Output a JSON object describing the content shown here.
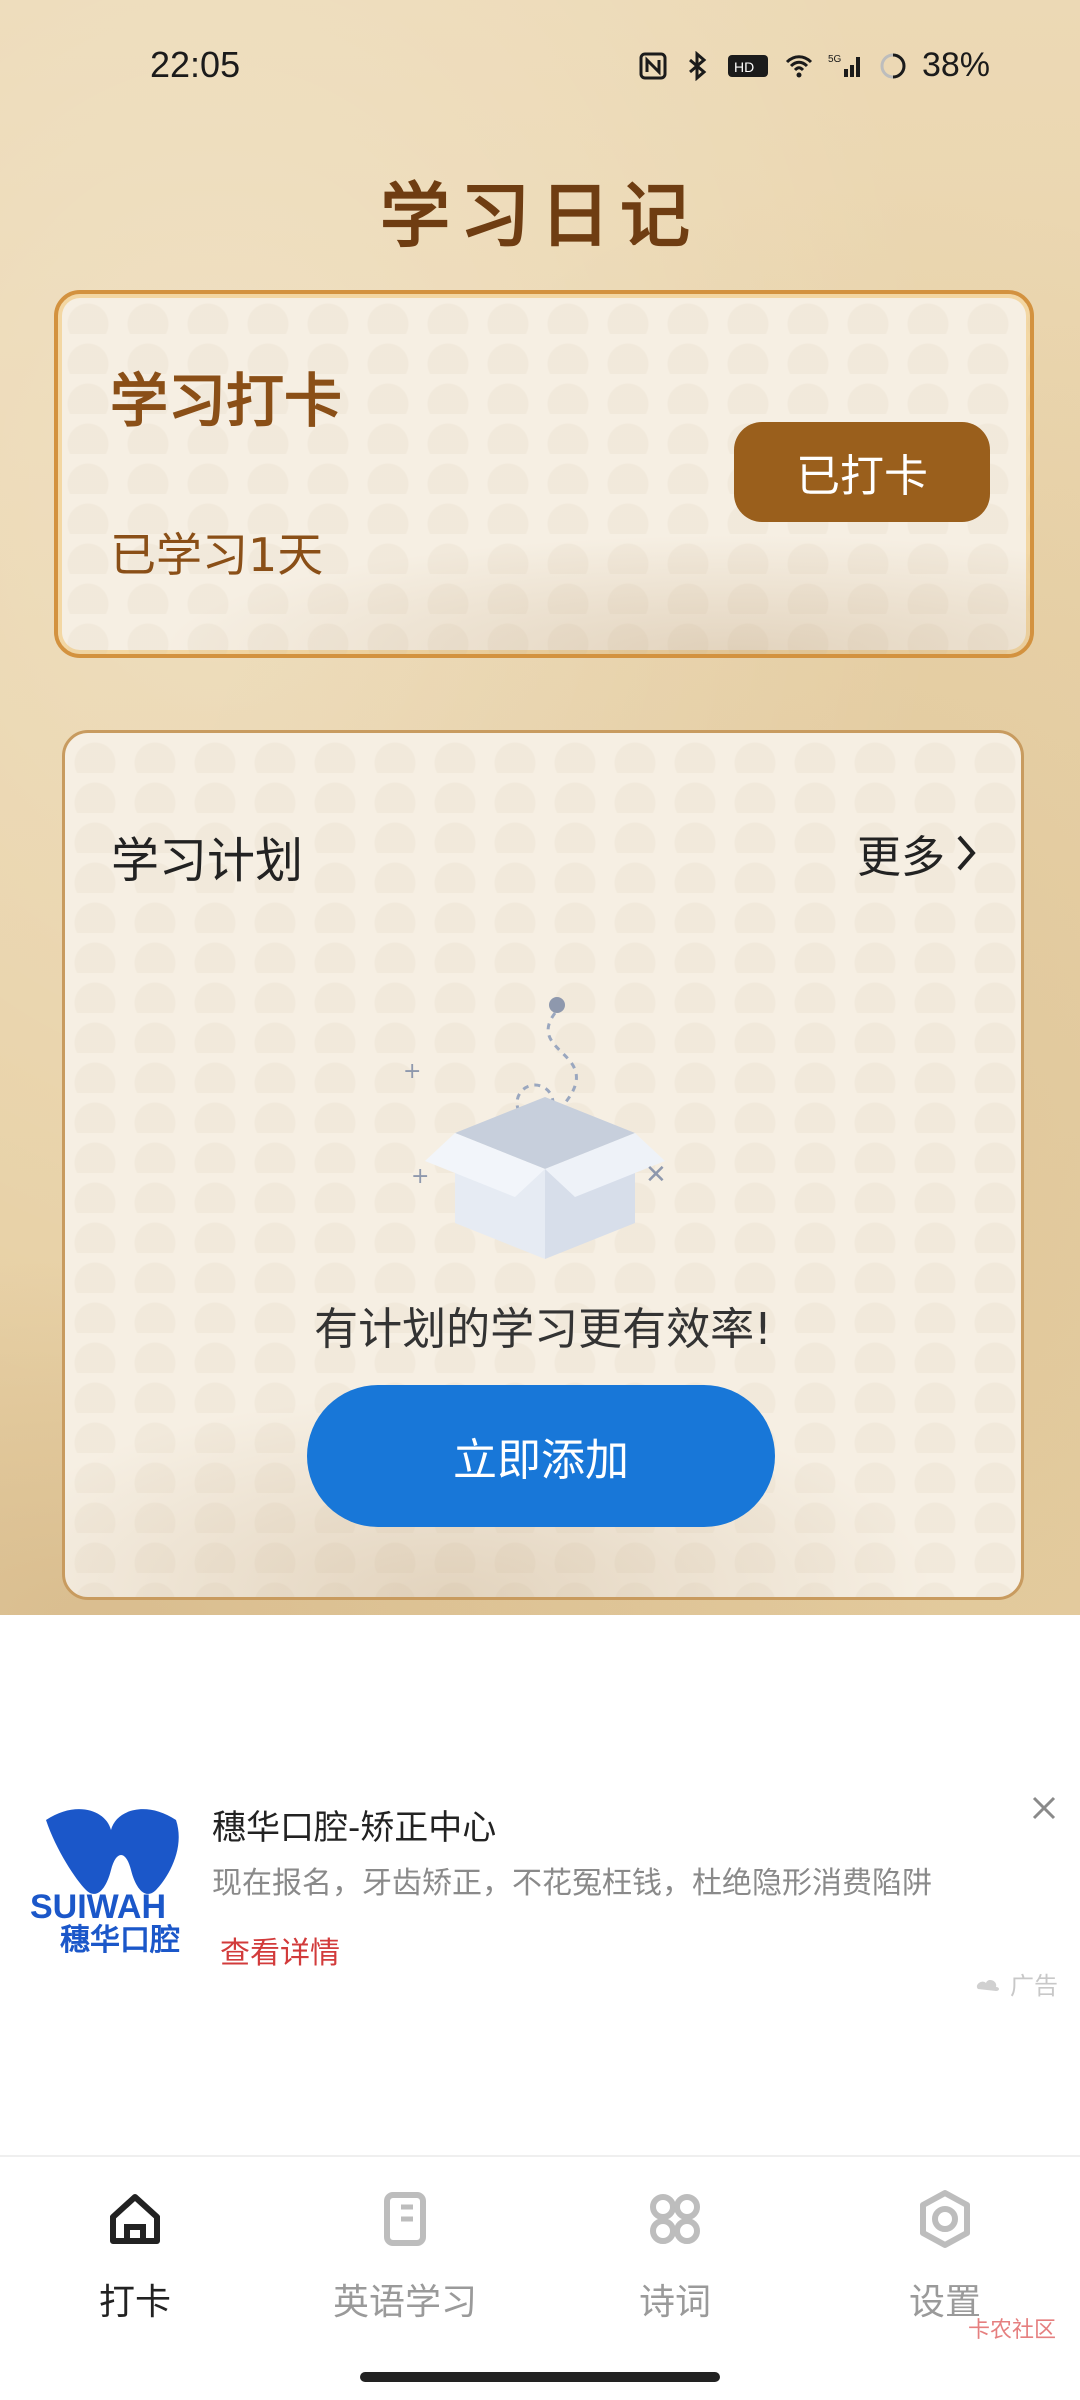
{
  "status_bar": {
    "time": "22:05",
    "battery": "38%",
    "icons": [
      "nfc-icon",
      "bluetooth-icon",
      "hd-icon",
      "wifi-icon",
      "signal-icon",
      "battery-ring-icon"
    ]
  },
  "header": {
    "title": "学习日记"
  },
  "checkin_card": {
    "title": "学习打卡",
    "days_label": "已学习1天",
    "button_label": "已打卡"
  },
  "plan_card": {
    "title": "学习计划",
    "more_label": "更多",
    "empty_text": "有计划的学习更有效率!",
    "add_button_label": "立即添加"
  },
  "ad": {
    "title": "穗华口腔-矫正中心",
    "description": "现在报名，牙齿矫正，不花冤枉钱，杜绝隐形消费陷阱",
    "link_label": "查看详情",
    "tag": "广告",
    "logo_text_en": "SUIWAH",
    "logo_text_cn": "穗华口腔"
  },
  "bottom_nav": {
    "items": [
      {
        "label": "打卡",
        "icon": "home-icon",
        "active": true
      },
      {
        "label": "英语学习",
        "icon": "notebook-icon",
        "active": false
      },
      {
        "label": "诗词",
        "icon": "grid-icon",
        "active": false
      },
      {
        "label": "设置",
        "icon": "settings-icon",
        "active": false
      }
    ]
  },
  "watermark": "卡农社区"
}
